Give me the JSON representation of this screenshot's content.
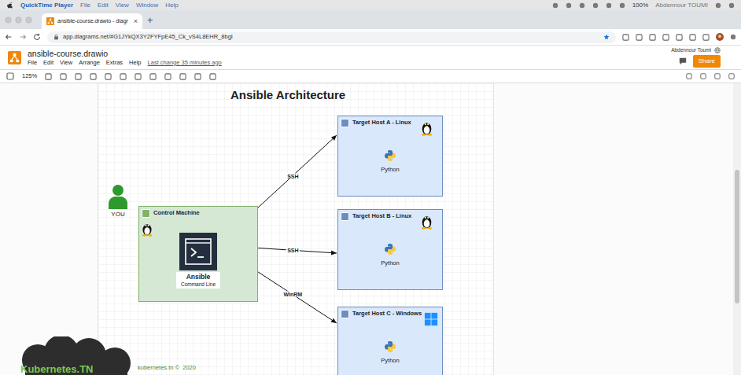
{
  "os_menubar": {
    "app": "QuickTime Player",
    "items": [
      "File",
      "Edit",
      "View",
      "Window",
      "Help"
    ],
    "battery": "100%",
    "user": "Abdennour TOUMI"
  },
  "browser": {
    "tab": {
      "title": "ansible-course.drawio - diagr",
      "selected": true
    },
    "close": "×",
    "new_tab": "+",
    "url": "app.diagrams.net/#G1JYkQX3Y2FYFpE45_Ck_vS4L8EHR_8bgI"
  },
  "app": {
    "title": "ansible-course.drawio",
    "menu": [
      "File",
      "Edit",
      "View",
      "Arrange",
      "Extras",
      "Help"
    ],
    "last_change": "Last change 35 minutes ago",
    "user": "Abdennour Toumi",
    "share": "Share"
  },
  "toolbar": {
    "zoom": "125%"
  },
  "diagram": {
    "title": "Ansible Architecture",
    "user_label": "YOU",
    "control": {
      "label": "Control Machine",
      "tool": "Ansible",
      "tool_sub": "Command Line"
    },
    "hosts": [
      {
        "label": "Target Host A - Linux",
        "kind": "linux",
        "runtime": "Python"
      },
      {
        "label": "Target Host B - Linux",
        "kind": "linux",
        "runtime": "Python"
      },
      {
        "label": "Target Host C - Windows",
        "kind": "windows",
        "runtime": "Python"
      }
    ],
    "edges": [
      {
        "label": "SSH",
        "to": 0
      },
      {
        "label": "SSH",
        "to": 1
      },
      {
        "label": "WinRM",
        "to": 2
      }
    ]
  },
  "footer": {
    "brand": "Kubernetes.TN",
    "credit": "kubernetes.tn ©  2020"
  }
}
